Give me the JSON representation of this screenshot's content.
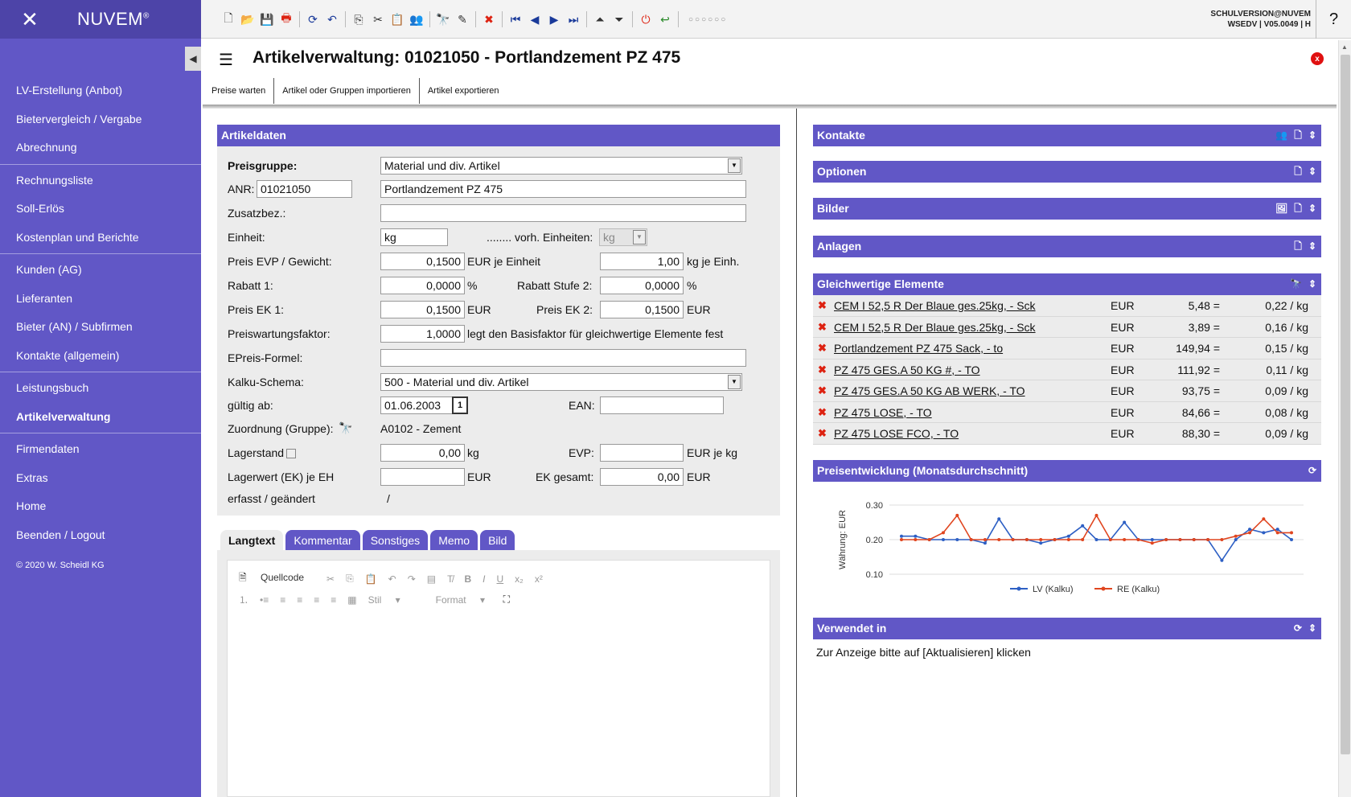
{
  "brand": {
    "name": "NUVEM",
    "reg": "®"
  },
  "nav": {
    "groups": [
      [
        "LV-Erstellung (Anbot)",
        "Bietervergleich / Vergabe",
        "Abrechnung"
      ],
      [
        "Rechnungsliste",
        "Soll-Erlös",
        "Kostenplan und Berichte"
      ],
      [
        "Kunden (AG)",
        "Lieferanten",
        "Bieter (AN) / Subfirmen",
        "Kontakte (allgemein)"
      ],
      [
        "Leistungsbuch",
        "Artikelverwaltung"
      ],
      [
        "Firmendaten",
        "Extras",
        "Home",
        "Beenden / Logout"
      ]
    ],
    "active": "Artikelverwaltung",
    "copyright": "© 2020 W. Scheidl KG"
  },
  "topbar": {
    "user_line1": "SCHULVERSION@NUVEM",
    "user_line2": "WSEDV | V05.0049 | H",
    "help": "?"
  },
  "page": {
    "title": "Artikelverwaltung: 01021050 - Portlandzement PZ 475",
    "close": "x",
    "subtabs": [
      "Preise warten",
      "Artikel oder Gruppen importieren",
      "Artikel exportieren"
    ]
  },
  "article": {
    "header": "Artikeldaten",
    "preisgruppe_label": "Preisgruppe:",
    "preisgruppe_value": "Material und div. Artikel",
    "anr_label": "ANR:",
    "anr_value": "01021050",
    "bezeichnung": "Portlandzement PZ 475",
    "zusatz_label": "Zusatzbez.:",
    "zusatz_value": "",
    "einheit_label": "Einheit:",
    "einheit_value": "kg",
    "vorh_label": "........ vorh. Einheiten:",
    "vorh_value": "kg",
    "evp_label": "Preis EVP / Gewicht:",
    "evp_value": "0,1500",
    "evp_unit": "EUR je Einheit",
    "gewicht_value": "1,00",
    "gewicht_unit": "kg je Einh.",
    "rabatt1_label": "Rabatt 1:",
    "rabatt1_value": "0,0000",
    "pct": "%",
    "rabatt2_label": "Rabatt Stufe 2:",
    "rabatt2_value": "0,0000",
    "ek1_label": "Preis EK 1:",
    "ek1_value": "0,1500",
    "ek2_label": "Preis EK 2:",
    "ek2_value": "0,1500",
    "eur": "EUR",
    "pwf_label": "Preiswartungsfaktor:",
    "pwf_value": "1,0000",
    "pwf_note": "legt den Basisfaktor für gleichwertige Elemente fest",
    "formel_label": "EPreis-Formel:",
    "formel_value": "",
    "kalku_label": "Kalku-Schema:",
    "kalku_value": "500 - Material und div. Artikel",
    "gueltig_label": "gültig ab:",
    "gueltig_value": "01.06.2003",
    "cal": "1",
    "ean_label": "EAN:",
    "ean_value": "",
    "zuord_label": "Zuordnung (Gruppe):",
    "zuord_value": "A0102 - Zement",
    "lager_label": "Lagerstand",
    "lager_value": "0,00",
    "lager_unit": "kg",
    "evp2_label": "EVP:",
    "evp2_value": "",
    "evp2_unit": "EUR je kg",
    "lagerwert_label": "Lagerwert (EK) je EH",
    "lagerwert_value": "",
    "ekges_label": "EK gesamt:",
    "ekges_value": "0,00",
    "erfasst_label": "erfasst / geändert",
    "erfasst_value": "/"
  },
  "texttabs": [
    "Langtext",
    "Kommentar",
    "Sonstiges",
    "Memo",
    "Bild"
  ],
  "editor": {
    "source": "Quellcode",
    "style": "Stil",
    "format": "Format"
  },
  "panels": {
    "kontakte": "Kontakte",
    "optionen": "Optionen",
    "bilder": "Bilder",
    "anlagen": "Anlagen",
    "gleichwertig": "Gleichwertige Elemente",
    "preisentwicklung": "Preisentwicklung (Monatsdurchschnitt)",
    "verwendet": "Verwendet in",
    "verwendet_text": "Zur Anzeige bitte auf [Aktualisieren] klicken"
  },
  "equivalents": [
    {
      "name": "CEM I 52,5 R Der Blaue ges.25kg, - Sck",
      "cur": "EUR",
      "price": "5,48 =",
      "per": "0,22 / kg"
    },
    {
      "name": "CEM I 52,5 R Der Blaue ges.25kg, - Sck",
      "cur": "EUR",
      "price": "3,89 =",
      "per": "0,16 / kg"
    },
    {
      "name": "Portlandzement PZ 475 Sack, - to",
      "cur": "EUR",
      "price": "149,94 =",
      "per": "0,15 / kg"
    },
    {
      "name": "PZ 475 GES.A 50 KG #, - TO",
      "cur": "EUR",
      "price": "111,92 =",
      "per": "0,11 / kg"
    },
    {
      "name": "PZ 475 GES.A 50 KG AB WERK, - TO",
      "cur": "EUR",
      "price": "93,75 =",
      "per": "0,09 / kg"
    },
    {
      "name": "PZ 475 LOSE, - TO",
      "cur": "EUR",
      "price": "84,66 =",
      "per": "0,08 / kg"
    },
    {
      "name": "PZ 475 LOSE FCO, - TO",
      "cur": "EUR",
      "price": "88,30 =",
      "per": "0,09 / kg"
    }
  ],
  "chart_data": {
    "type": "line",
    "ylabel": "Währung: EUR",
    "ylim": [
      0.1,
      0.3
    ],
    "yticks": [
      "0.30",
      "0.20",
      "0.10"
    ],
    "legend_position": "bottom",
    "series": [
      {
        "name": "LV (Kalku)",
        "color": "#2d5fc4",
        "values": [
          0.21,
          0.21,
          0.2,
          0.2,
          0.2,
          0.2,
          0.19,
          0.26,
          0.2,
          0.2,
          0.19,
          0.2,
          0.21,
          0.24,
          0.2,
          0.2,
          0.25,
          0.2,
          0.2,
          0.2,
          0.2,
          0.2,
          0.2,
          0.14,
          0.2,
          0.23,
          0.22,
          0.23,
          0.2
        ]
      },
      {
        "name": "RE (Kalku)",
        "color": "#e0451f",
        "values": [
          0.2,
          0.2,
          0.2,
          0.22,
          0.27,
          0.2,
          0.2,
          0.2,
          0.2,
          0.2,
          0.2,
          0.2,
          0.2,
          0.2,
          0.27,
          0.2,
          0.2,
          0.2,
          0.19,
          0.2,
          0.2,
          0.2,
          0.2,
          0.2,
          0.21,
          0.22,
          0.26,
          0.22,
          0.22
        ]
      }
    ]
  }
}
